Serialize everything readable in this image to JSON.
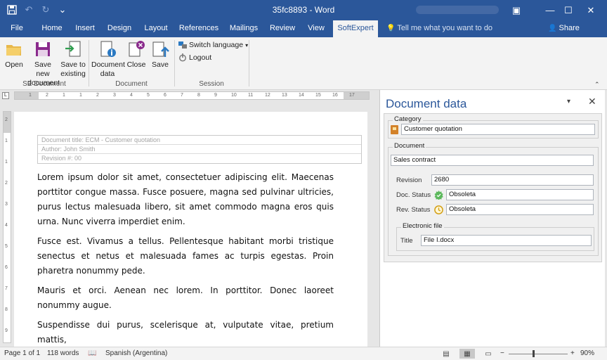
{
  "window": {
    "title": "35fc8893 - Word",
    "controls": {
      "ribbon_options": "▣",
      "minimize": "—",
      "maximize": "☐",
      "close": "✕"
    }
  },
  "qat": {
    "save": "💾",
    "undo": "↶",
    "redo": "↻",
    "customize": "⌄"
  },
  "tabs": [
    {
      "label": "File"
    },
    {
      "label": "Home"
    },
    {
      "label": "Insert"
    },
    {
      "label": "Design"
    },
    {
      "label": "Layout"
    },
    {
      "label": "References"
    },
    {
      "label": "Mailings"
    },
    {
      "label": "Review"
    },
    {
      "label": "View"
    },
    {
      "label": "SoftExpert"
    }
  ],
  "tell_me": {
    "icon": "💡",
    "placeholder": "Tell me what you want to do"
  },
  "share": {
    "icon": "👤",
    "label": "Share"
  },
  "ribbon": {
    "se_document": {
      "label": "SE Document",
      "open": "Open",
      "save_new_line1": "Save new",
      "save_new_line2": "document",
      "save_existing_line1": "Save to",
      "save_existing_line2": "existing"
    },
    "document": {
      "label": "Document",
      "doc_data_line1": "Document",
      "doc_data_line2": "data",
      "close": "Close",
      "save": "Save"
    },
    "session": {
      "label": "Session",
      "switch_language": "Switch language",
      "dropdown_arrow": "▾",
      "logout": "Logout"
    },
    "collapse": "⌃"
  },
  "ruler": {
    "corner": "L",
    "ticks": [
      "1",
      "2",
      "1",
      "1",
      "2",
      "3",
      "4",
      "5",
      "6",
      "7",
      "8",
      "9",
      "10",
      "11",
      "12",
      "13",
      "14",
      "15",
      "16",
      "17"
    ],
    "vticks": [
      "2",
      "1",
      "1",
      "2",
      "3",
      "4",
      "5",
      "6",
      "7",
      "8",
      "9"
    ]
  },
  "document": {
    "meta": [
      "Document title: ECM - Customer quotation",
      "Author: John Smith",
      "Revision #: 00"
    ],
    "paragraphs": [
      "Lorem ipsum dolor sit amet, consectetuer adipiscing elit. Maecenas porttitor congue massa. Fusce posuere, magna sed pulvinar ultricies, purus lectus malesuada libero, sit amet commodo magna eros quis urna. Nunc viverra imperdiet enim.",
      "Fusce est. Vivamus a tellus. Pellentesque habitant morbi tristique senectus et netus et malesuada fames ac turpis egestas. Proin pharetra nonummy pede.",
      "Mauris et orci. Aenean nec lorem. In porttitor. Donec laoreet nonummy augue.",
      "Suspendisse dui purus, scelerisque at, vulputate vitae, pretium mattis,"
    ]
  },
  "pane": {
    "title": "Document data",
    "dropdown": "▾",
    "close": "✕",
    "category": {
      "legend": "Category",
      "value": "Customer quotation"
    },
    "document": {
      "legend": "Document",
      "type_value": "Sales contract",
      "revision_label": "Revision",
      "revision_value": "2680",
      "doc_status_label": "Doc. Status",
      "doc_status_value": "Obsoleta",
      "rev_status_label": "Rev. Status",
      "rev_status_value": "Obsoleta"
    },
    "electronic_file": {
      "legend": "Electronic file",
      "title_label": "Title",
      "title_value": "File I.docx"
    }
  },
  "statusbar": {
    "page": "Page 1 of 1",
    "words": "118 words",
    "proofing_icon": "📖",
    "language": "Spanish (Argentina)",
    "view_read": "▤",
    "view_print": "▦",
    "view_web": "▭",
    "zoom_minus": "−",
    "zoom_plus": "+",
    "zoom": "90%"
  },
  "colors": {
    "accent": "#2b579a",
    "status_ok": "#5cb85c",
    "status_clock": "#d4a017"
  }
}
